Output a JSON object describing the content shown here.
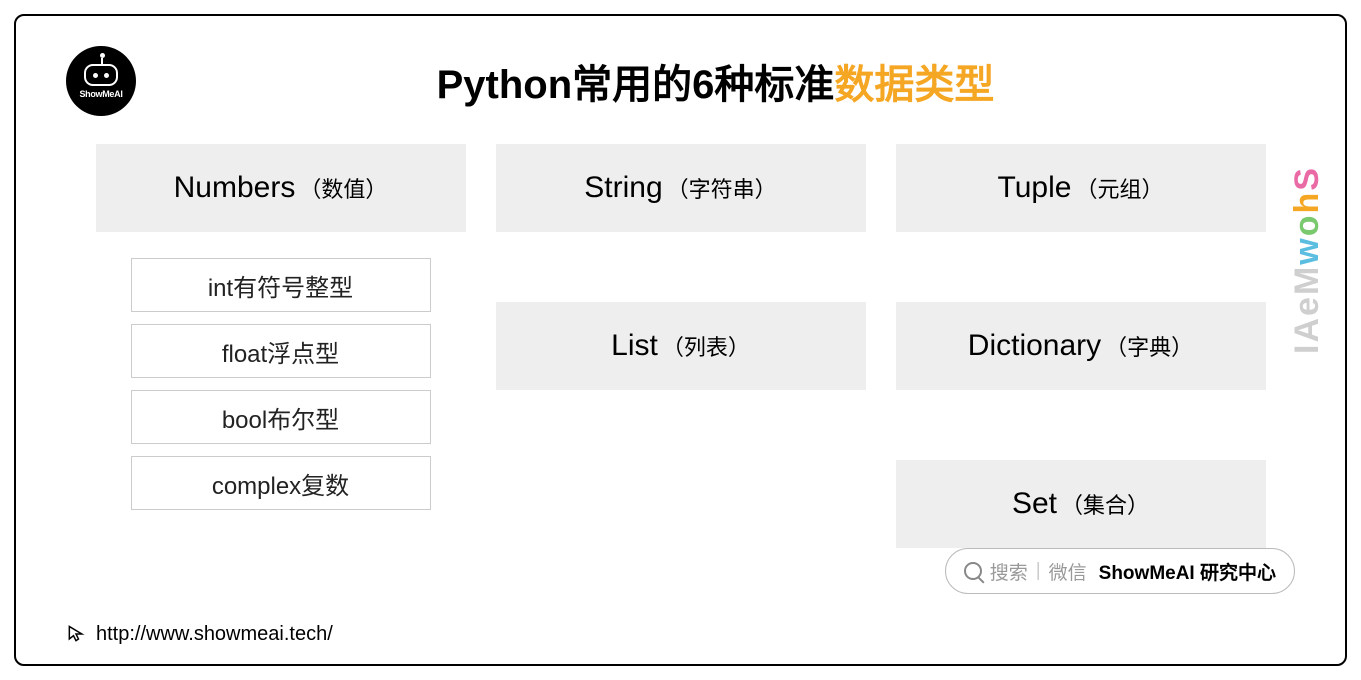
{
  "logo_text": "ShowMeAI",
  "title_prefix": "Python常用的6种标准",
  "title_accent": "数据类型",
  "cards": {
    "numbers_en": "Numbers",
    "numbers_zh": "（数值）",
    "string_en": "String",
    "string_zh": "（字符串）",
    "tuple_en": "Tuple",
    "tuple_zh": "（元组）",
    "list_en": "List",
    "list_zh": "（列表）",
    "dict_en": "Dictionary",
    "dict_zh": "（字典）",
    "set_en": "Set",
    "set_zh": "（集合）"
  },
  "number_types": {
    "t1": "int有符号整型",
    "t2": "float浮点型",
    "t3": "bool布尔型",
    "t4": "complex复数"
  },
  "search": {
    "label": "搜索",
    "wechat": "微信",
    "brand": "ShowMeAI 研究中心"
  },
  "url": "http://www.showmeai.tech/",
  "watermark": "ShowMeAI"
}
